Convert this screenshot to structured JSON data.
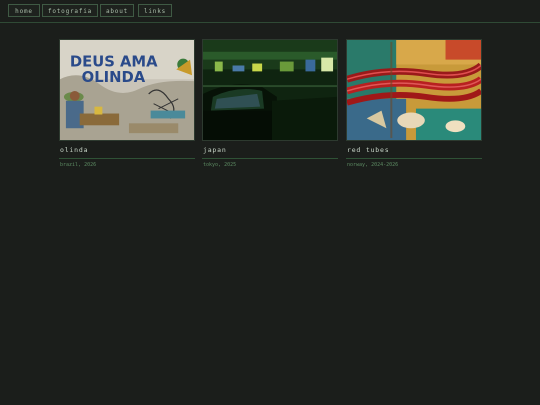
{
  "nav": {
    "items": [
      {
        "label": "home"
      },
      {
        "label": "fotografia"
      },
      {
        "label": "about"
      },
      {
        "label": "links"
      }
    ]
  },
  "gallery": {
    "cards": [
      {
        "title": "olinda",
        "meta": "brazil, 2026",
        "image_text_1": "DEUS AMA",
        "image_text_2": "OLINDA"
      },
      {
        "title": "japan",
        "meta": "tokyo, 2025"
      },
      {
        "title": "red tubes",
        "meta": "norway, 2024-2026"
      }
    ]
  },
  "colors": {
    "background": "#1b1e1b",
    "accent": "#2f5236",
    "meta_text": "#5c8a62"
  }
}
